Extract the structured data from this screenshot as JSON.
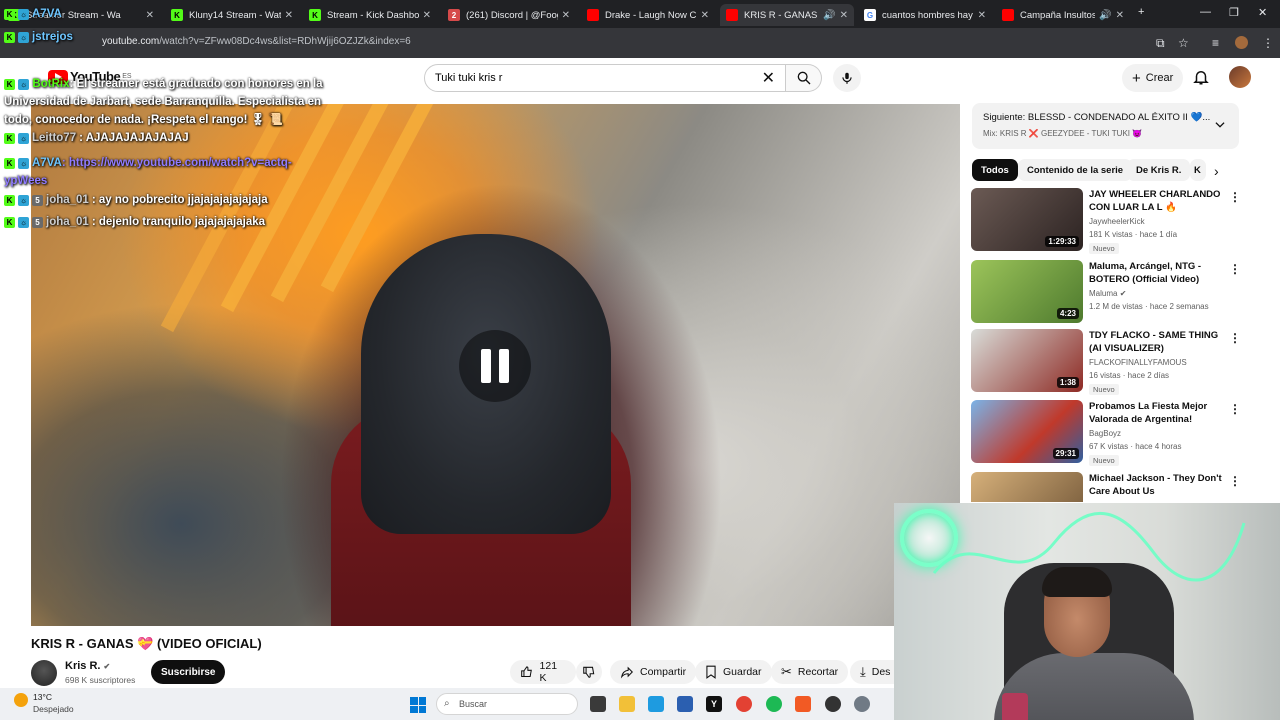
{
  "browser": {
    "tabs": [
      {
        "title": "Streamer Stream - Wa",
        "favicon": "kick-icon",
        "active": false
      },
      {
        "title": "Kluny14 Stream - Watch L",
        "favicon": "kick-icon",
        "active": false
      },
      {
        "title": "Stream - Kick Dashboard",
        "favicon": "kick-icon",
        "active": false
      },
      {
        "title": "(261) Discord | @Fooger",
        "favicon": "discord-icon",
        "active": false
      },
      {
        "title": "Drake - Laugh Now Cry L",
        "favicon": "youtube-icon",
        "active": false
      },
      {
        "title": "KRIS R - GANAS 💝 (",
        "favicon": "youtube-icon",
        "active": true
      },
      {
        "title": "cuantos hombres hay en",
        "favicon": "google-icon",
        "active": false
      },
      {
        "title": "Campaña Insultos - Y",
        "favicon": "youtube-icon",
        "active": false
      }
    ],
    "url_host": "youtube.com",
    "url_path": "/watch?v=ZFww08Dc4ws&list=RDhWjij6OZJZk&index=6"
  },
  "youtube": {
    "logo_text": "YouTube",
    "logo_region": "ES",
    "search_value": "Tuki tuki kris r",
    "create_label": "Crear"
  },
  "chat": {
    "lines": [
      {
        "user": "A7VA",
        "msg": "",
        "color": "blue"
      },
      {
        "user": "jstrejos",
        "msg": "",
        "color": "blue"
      },
      {
        "user": "BotRix",
        "msg": ": El streamer está graduado con honores en la Universidad de Jarbart, sede Barranquilla. Especialista en todo, conocedor de nada. ¡Respeta el rango! 🎖 📜",
        "color": "green"
      },
      {
        "user": "Leitto77",
        "msg": ": AJAJAJAJAJAJAJ",
        "color": "blue"
      },
      {
        "user": "A7VA",
        "msg": ": https://www.youtube.com/watch?v=actq-ypWees",
        "color": "blue"
      },
      {
        "user": "joha_01",
        "msg": ": ay no pobrecito jjajajajajajajaja",
        "color": "gray"
      },
      {
        "user": "joha_01",
        "msg": ": dejenlo tranquilo jajajajajajaka",
        "color": "gray"
      }
    ]
  },
  "video": {
    "title": "KRIS R - GANAS 💝 (VIDEO OFICIAL)",
    "channel": "Kris R.",
    "subscribers": "698 K suscriptores",
    "subscribe_label": "Suscribirse",
    "likes": "121 K",
    "share_label": "Compartir",
    "save_label": "Guardar",
    "clip_label": "Recortar",
    "download_label": "Des"
  },
  "sidebar": {
    "next_title": "Siguiente: BLESSD - CONDENADO AL ÉXITO II 💙...",
    "next_sub": "Mix: KRIS R ❌ GEEZYDEE - TUKI TUKI 😈",
    "chips": [
      "Todos",
      "Contenido de la serie",
      "De Kris R.",
      "K"
    ],
    "recs": [
      {
        "title": "JAY WHEELER CHARLANDO CON LUAR LA L 🔥 COMPLETO",
        "channel": "JaywheelerKick",
        "meta": "181 K vistas · hace 1 día",
        "duration": "1:29:33",
        "badge": "Nuevo",
        "thumb": "#3a2f2c"
      },
      {
        "title": "Maluma, Arcángel, NTG - BOTERO (Official Video)",
        "channel": "Maluma",
        "meta": "1.2 M de vistas · hace 2 semanas",
        "duration": "4:23",
        "badge": "",
        "thumb": "#6aa043"
      },
      {
        "title": "TDY FLACKO - SAME THING (AI VISUALIZER)",
        "channel": "FLACKOFINALLYFAMOUS",
        "meta": "16 vistas · hace 2 días",
        "duration": "1:38",
        "badge": "Nuevo",
        "thumb": "#8e2a24"
      },
      {
        "title": "Probamos La Fiesta Mejor Valorada de Argentina!",
        "channel": "BagBoyz",
        "meta": "67 K vistas · hace 4 horas",
        "duration": "29:31",
        "badge": "Nuevo",
        "thumb": "#3a6fb7"
      },
      {
        "title": "Michael Jackson - They Don't Care About Us",
        "channel": "",
        "meta": "",
        "duration": "",
        "badge": "",
        "thumb": "#b08a5c"
      }
    ]
  },
  "taskbar": {
    "temperature": "13°C",
    "condition": "Despejado",
    "search_placeholder": "Buscar"
  }
}
